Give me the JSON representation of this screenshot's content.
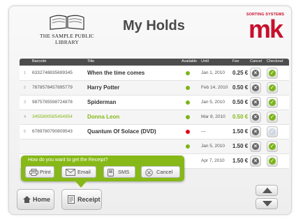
{
  "header": {
    "library_line1": "THE SAMPLE PUBLIC",
    "library_line2": "LIBRARY",
    "page_title": "My Holds",
    "brand_text": "SORTING SYSTEMS",
    "brand_mark": "mk"
  },
  "table": {
    "columns": [
      "Barcode",
      "Title",
      "Available",
      "Until",
      "Fee",
      "Cancel",
      "Checkout"
    ],
    "rows": [
      {
        "num": "1",
        "barcode": "6332748835699345",
        "title": "When the time comes",
        "until": "Jan 1, 2010",
        "fee": "0.25 €",
        "available": "green",
        "highlight": false,
        "checkout_enabled": true
      },
      {
        "num": "2",
        "barcode": "7878578457895779",
        "title": "Harry Potter",
        "until": "Feb 14, 2010",
        "fee": "0.50 €",
        "available": "green",
        "highlight": false,
        "checkout_enabled": true
      },
      {
        "num": "3",
        "barcode": "9875785598724878",
        "title": "Spiderman",
        "until": "Jan 5, 2010",
        "fee": "0.50 €",
        "available": "green",
        "highlight": false,
        "checkout_enabled": true
      },
      {
        "num": "4",
        "barcode": "3455890585454954",
        "title": "Donna Leon",
        "until": "Mar 8, 2010",
        "fee": "0.50 €",
        "available": "green",
        "highlight": true,
        "checkout_enabled": true
      },
      {
        "num": "5",
        "barcode": "6789780790809543",
        "title": "Quantum Of Solace (DVD)",
        "until": "—",
        "fee": "1.50 €",
        "available": "red",
        "highlight": false,
        "checkout_enabled": false
      },
      {
        "num": "",
        "barcode": "",
        "title": "",
        "until": "Jan 5, 2010",
        "fee": "1.50 €",
        "available": "green",
        "highlight": false,
        "checkout_enabled": true
      },
      {
        "num": "",
        "barcode": "",
        "title": "",
        "until": "Apr 7, 2010",
        "fee": "1.50 €",
        "available": "none",
        "highlight": false,
        "checkout_enabled": true
      }
    ]
  },
  "receipt_popup": {
    "question": "How do you want to get the Receipt?",
    "print_label": "Print",
    "email_label": "Email",
    "sms_label": "SMS",
    "cancel_label": "Cancel"
  },
  "footer": {
    "home_label": "Home",
    "receipt_label": "Receipt"
  },
  "colors": {
    "accent_green": "#86b817",
    "brand_red": "#c8102e",
    "available_green": "#7cb518",
    "unavailable_red": "#e8001c",
    "header_bar": "#4d4d4d"
  },
  "icons": [
    "book-logo-icon",
    "cancel-x-icon",
    "checkout-check-icon",
    "printer-icon",
    "email-icon",
    "sms-icon",
    "home-icon",
    "receipt-icon",
    "arrow-up-icon",
    "arrow-down-icon"
  ]
}
